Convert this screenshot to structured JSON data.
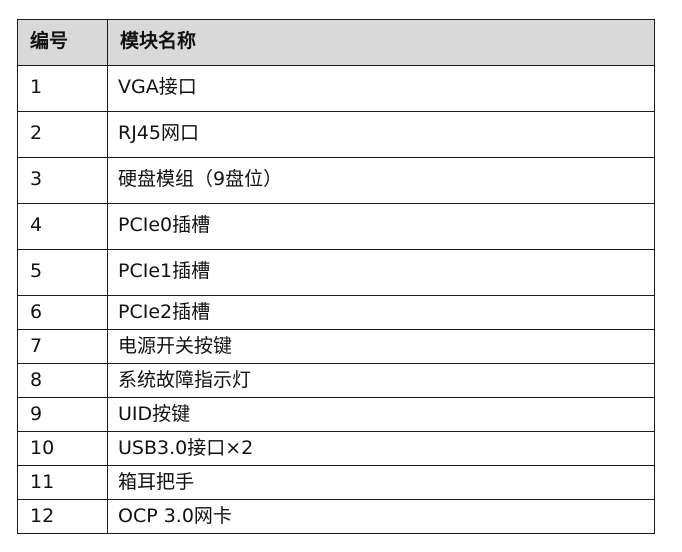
{
  "table": {
    "headers": [
      "编号",
      "模块名称"
    ],
    "rows": [
      {
        "no": "1",
        "name": "VGA接口"
      },
      {
        "no": "2",
        "name": "RJ45网口"
      },
      {
        "no": "3",
        "name": "硬盘模组（9盘位）"
      },
      {
        "no": "4",
        "name": "PCIe0插槽"
      },
      {
        "no": "5",
        "name": "PCIe1插槽"
      },
      {
        "no": "6",
        "name": "PCIe2插槽"
      },
      {
        "no": "7",
        "name": "电源开关按键"
      },
      {
        "no": "8",
        "name": "系统故障指示灯"
      },
      {
        "no": "9",
        "name": "UID按键"
      },
      {
        "no": "10",
        "name": "USB3.0接口×2"
      },
      {
        "no": "11",
        "name": "箱耳把手"
      },
      {
        "no": "12",
        "name": "OCP 3.0网卡"
      }
    ]
  }
}
